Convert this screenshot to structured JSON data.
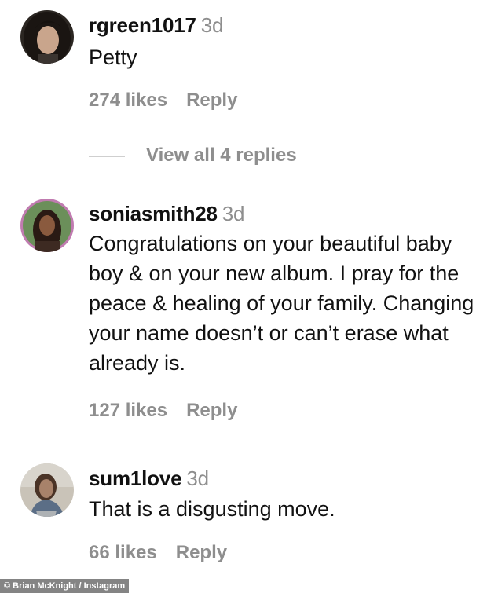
{
  "comments": [
    {
      "username": "rgreen1017",
      "time": "3d",
      "text": "Petty",
      "likes": "274 likes",
      "reply": "Reply",
      "view_replies": "View all 4 replies"
    },
    {
      "username": "soniasmith28",
      "time": "3d",
      "text": "Congratulations on your beautiful baby boy & on your new album. I pray for the peace & healing of your family. Changing your name doesn’t or can’t erase what already is.",
      "likes": "127 likes",
      "reply": "Reply"
    },
    {
      "username": "sum1love",
      "time": "3d",
      "text": "That is a disgusting move.",
      "likes": "66 likes",
      "reply": "Reply"
    }
  ],
  "credit": "© Brian McKnight / Instagram"
}
